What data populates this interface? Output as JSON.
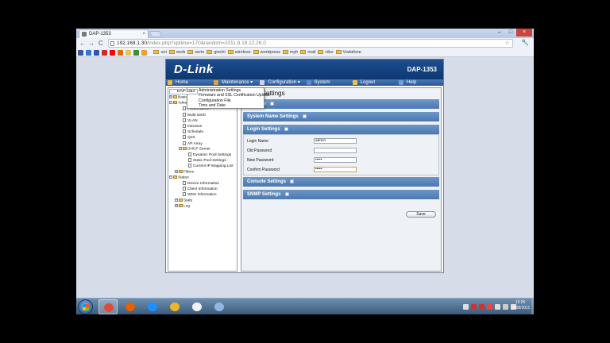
{
  "browser": {
    "tab_title": "DAP-1353",
    "tab_close": "×",
    "window_controls": [
      "–",
      "□",
      "×"
    ],
    "nav": {
      "back": "←",
      "forward": "→",
      "reload": "C"
    },
    "url": {
      "host": "192.168.1.30",
      "path": "/index.php?uptime=170&random=2011.8.18.12.26.0"
    },
    "star": "☆",
    "wrench": "🔧",
    "bookmark_icon_colors": [
      "#3b5998",
      "#2d7bd0",
      "#3355aa",
      "#cc2b2b",
      "#ff0000",
      "#e07000",
      "#e9c35a",
      "#3a8f3a",
      "#e9a030"
    ],
    "bookmarks": [
      "uni",
      "work",
      "serie",
      "giochi",
      "wireless",
      "wordpress",
      "myh",
      "mail",
      "cibo",
      "Vodafone"
    ]
  },
  "app": {
    "logo": "D-Link",
    "model": "DAP-1353",
    "menu": [
      {
        "label": "Home",
        "icon_color": "#e8b64a"
      },
      {
        "label": "Maintenance ▾",
        "icon_color": "#d8a445"
      },
      {
        "label": "Configuration ▾",
        "icon_color": "#c9d4e6"
      },
      {
        "label": "System",
        "icon_color": "#5e8ad1"
      },
      {
        "label": "Logout",
        "icon_color": "#e8c24a"
      },
      {
        "label": "Help",
        "icon_color": "#6f9fd8"
      }
    ],
    "tree": {
      "root": "DAP-1353",
      "basic": "Basic Sett",
      "advanced": "Advanced",
      "advanced_items": [
        "Performance",
        "Multi-SSID",
        "VLAN",
        "Intrusion",
        "Schedule",
        "QoS",
        "AP Array"
      ],
      "dhcp": "DHCP Server",
      "dhcp_items": [
        "Dynamic Pool Settings",
        "Static Pool Settings",
        "Current IP Mapping List"
      ],
      "filters": "Filters",
      "status": "Status",
      "status_items": [
        "Device Information",
        "Client Information",
        "WDS Information"
      ],
      "stats": "Stats",
      "log": "Log"
    },
    "popup_menu": [
      "Administration Settings",
      "Firmware and SSL Certification Upload",
      "Configuration File",
      "Time and Date"
    ],
    "main": {
      "title": "ation Settings",
      "sections": [
        "nistrator",
        "System Name Settings",
        "Login Settings",
        "Console Settings",
        "SNMP Settings"
      ],
      "fields": [
        {
          "label": "Login Name",
          "value": "admin"
        },
        {
          "label": "Old Password",
          "value": ""
        },
        {
          "label": "New Password",
          "value": "•••••"
        },
        {
          "label": "Confirm Password",
          "value": "•••••"
        }
      ],
      "save": "Save"
    }
  },
  "taskbar": {
    "apps": [
      {
        "name": "chrome",
        "color": "#dd4b39",
        "active": true
      },
      {
        "name": "firefox",
        "color": "#e66000",
        "active": false
      },
      {
        "name": "internet-explorer",
        "color": "#1e90ff",
        "active": false
      },
      {
        "name": "outlook",
        "color": "#f0b429",
        "active": false
      },
      {
        "name": "explorer",
        "color": "#f2f2f2",
        "active": false
      },
      {
        "name": "network",
        "color": "#8fb5e0",
        "active": false
      }
    ],
    "tray_colors": [
      "#ddd",
      "#c33",
      "#c33",
      "#e44",
      "#ddd",
      "#ccc",
      "#ddd"
    ],
    "clock_time": "12:26",
    "clock_date": "18/08/2011"
  }
}
